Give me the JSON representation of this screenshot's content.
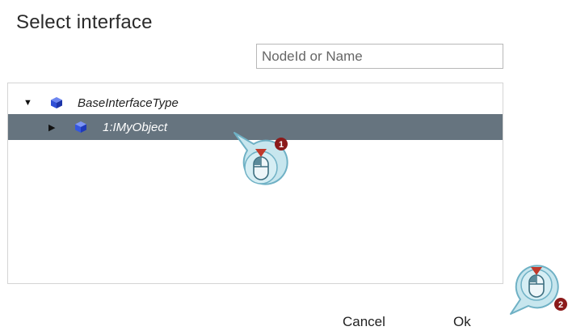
{
  "dialog": {
    "title": "Select interface",
    "search_placeholder": "NodeId or Name"
  },
  "tree": {
    "root": {
      "label": "BaseInterfaceType",
      "expanded": true,
      "icon": "cube-icon"
    },
    "child": {
      "label": "1:IMyObject",
      "expanded": false,
      "selected": true,
      "icon": "cube-icon"
    }
  },
  "buttons": {
    "cancel": "Cancel",
    "ok": "Ok"
  },
  "callouts": [
    {
      "step": "1",
      "action": "left-click"
    },
    {
      "step": "2",
      "action": "left-click"
    }
  ],
  "colors": {
    "selection": "#66747f",
    "cube_blue": "#2f4fd6",
    "callout_fill": "#c7e6ee",
    "callout_stroke": "#6fb1c5",
    "badge": "#8b1a1a",
    "mouse_arrow": "#c0392b"
  }
}
